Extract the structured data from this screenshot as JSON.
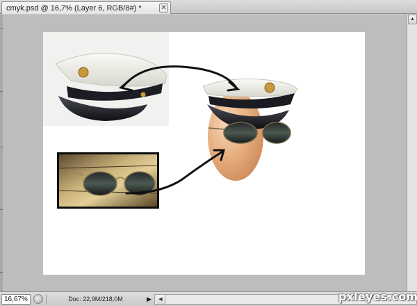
{
  "document": {
    "tab_title": "cmyk.psd @ 16,7% (Layer 6, RGB/8#) *",
    "close_glyph": "✕"
  },
  "status_bar": {
    "zoom": "16,67%",
    "doc_info": "Doc: 22,9M/218,0M",
    "menu_arrow": "▶"
  },
  "scrollbar": {
    "up_glyph": "▲",
    "left_glyph": "◀"
  },
  "watermark": "pxleyes.com",
  "colors": {
    "canvas": "#ffffff",
    "workspace": "#bdbdbd",
    "arrow": "#111111",
    "egg_face": "#e2a774"
  },
  "icons": [
    "close-icon",
    "status-menu-icon",
    "scroll-up-icon",
    "scroll-left-icon"
  ]
}
